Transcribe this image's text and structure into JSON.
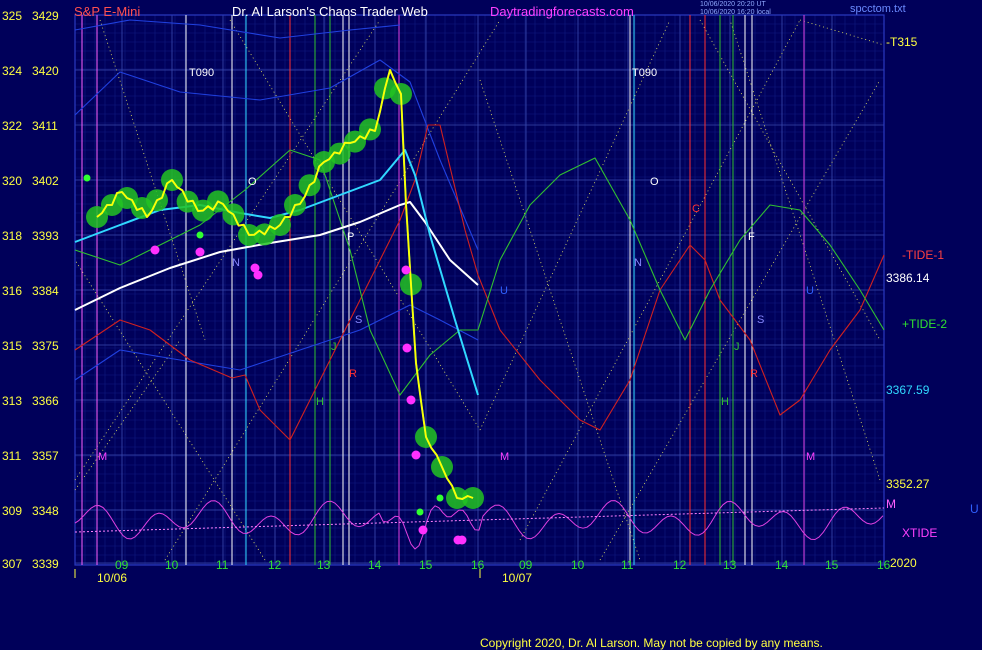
{
  "header": {
    "symbol": "S&P E-Mini",
    "title": "Dr. Al Larson's Chaos Trader Web",
    "site": "Daytradingforecasts.com",
    "timestamp1": "10/06/2020 20:20 UT",
    "timestamp2": "10/06/2020 16:20 local",
    "file": "spcctom.txt"
  },
  "footer": {
    "copyright": "Copyright 2020, Dr. Al Larson. May not be copied by any means."
  },
  "colors": {
    "background": "#00005a",
    "grid": "#3a4ab0",
    "price": "#ffff00",
    "price_glow": "#22c322",
    "ma_fast": "#30d8ff",
    "ma_slow": "#ffffff",
    "tide1": "#d02020",
    "tide2": "#30c030",
    "xtide": "#e040e0",
    "band": "#2040e0"
  },
  "chart_data": {
    "type": "line",
    "title": "S&P E-Mini",
    "y_axis_left": [
      {
        "level": "325",
        "price": "3429"
      },
      {
        "level": "324",
        "price": "3420"
      },
      {
        "level": "322",
        "price": "3411"
      },
      {
        "level": "320",
        "price": "3402"
      },
      {
        "level": "318",
        "price": "3393"
      },
      {
        "level": "316",
        "price": "3384"
      },
      {
        "level": "315",
        "price": "3375"
      },
      {
        "level": "313",
        "price": "3366"
      },
      {
        "level": "311",
        "price": "3357"
      },
      {
        "level": "309",
        "price": "3348"
      },
      {
        "level": "307",
        "price": "3339"
      }
    ],
    "ylim": [
      3339,
      3429
    ],
    "x_hours": [
      "09",
      "10",
      "11",
      "12",
      "13",
      "14",
      "15",
      "16",
      "09",
      "10",
      "11",
      "12",
      "13",
      "14",
      "15",
      "16"
    ],
    "x_dates": [
      "10/06",
      "10/07"
    ],
    "year_label": "2020",
    "series": [
      {
        "name": "S&P E-Mini",
        "hours": [
          8.5,
          9.0,
          9.5,
          10.0,
          10.5,
          11.0,
          11.5,
          12.0,
          12.5,
          13.0,
          13.5,
          14.0,
          14.3,
          14.5,
          14.6,
          14.8,
          15.0,
          15.3,
          15.6,
          15.9
        ],
        "values": [
          3396,
          3400,
          3396,
          3402,
          3397,
          3398,
          3393,
          3394,
          3398,
          3405,
          3408,
          3410,
          3420,
          3416,
          3398,
          3372,
          3360,
          3355,
          3350,
          3350
        ]
      },
      {
        "name": "-TIDE-1",
        "annotation": "3386.14"
      },
      {
        "name": "+TIDE-2"
      },
      {
        "name": "XTIDE"
      }
    ],
    "ma_values": [
      {
        "label": "3367.59"
      },
      {
        "label": "3352.27"
      }
    ],
    "right_labels": [
      "-T315",
      "-TIDE-1",
      "3386.14",
      "+TIDE-2",
      "3367.59",
      "3352.27",
      "M",
      "XTIDE",
      "U"
    ],
    "time_markers": [
      "T090",
      "T090"
    ],
    "letter_markers": [
      {
        "text": "O"
      },
      {
        "text": "P"
      },
      {
        "text": "N"
      },
      {
        "text": "S"
      },
      {
        "text": "J"
      },
      {
        "text": "R"
      },
      {
        "text": "H"
      },
      {
        "text": "M"
      },
      {
        "text": "M"
      },
      {
        "text": "U"
      },
      {
        "text": "O"
      },
      {
        "text": "C"
      },
      {
        "text": "N"
      },
      {
        "text": "F"
      },
      {
        "text": "S"
      },
      {
        "text": "J"
      },
      {
        "text": "R"
      },
      {
        "text": "H"
      },
      {
        "text": "M"
      },
      {
        "text": "U"
      }
    ],
    "grid": true
  }
}
